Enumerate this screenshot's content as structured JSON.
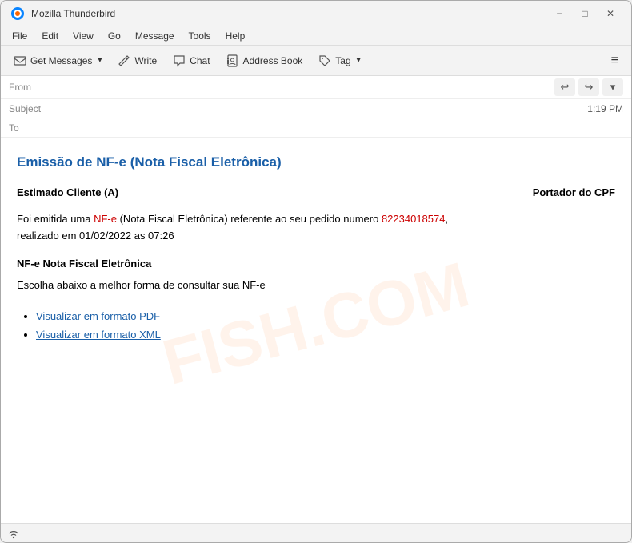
{
  "window": {
    "title": "Mozilla Thunderbird",
    "icon": "thunderbird"
  },
  "titlebar": {
    "title": "Mozilla Thunderbird",
    "minimize_label": "−",
    "maximize_label": "□",
    "close_label": "✕"
  },
  "menubar": {
    "items": [
      "File",
      "Edit",
      "View",
      "Go",
      "Message",
      "Tools",
      "Help"
    ]
  },
  "toolbar": {
    "get_messages_label": "Get Messages",
    "write_label": "Write",
    "chat_label": "Chat",
    "address_book_label": "Address Book",
    "tag_label": "Tag"
  },
  "email_header": {
    "from_label": "From",
    "subject_label": "Subject",
    "to_label": "To",
    "time": "1:19 PM",
    "from_value": "",
    "subject_value": "",
    "to_value": ""
  },
  "email": {
    "subject": "Emissão de NF-e (Nota Fiscal Eletrônica)",
    "greeting": "Estimado Cliente (A)",
    "cpf_label": "Portador do CPF",
    "body_before_nfe": "Foi emitida uma ",
    "nfe_highlight": "NF-e",
    "body_after_nfe": " (Nota Fiscal Eletrônica) referente ao seu pedido numero ",
    "order_number": "82234018574",
    "body_date": ",\nrealizado em 01/02/2022 as 07:26",
    "section_title": "NF-e Nota Fiscal Eletrônica",
    "body_consult": "Escolha abaixo a melhor forma de consultar sua NF-e",
    "link1_text": "Visualizar em formato PDF",
    "link2_text": "Visualizar em formato XML",
    "watermark": "FISH.COM"
  },
  "statusbar": {
    "wifi_icon": "wifi",
    "wifi_label": ""
  }
}
